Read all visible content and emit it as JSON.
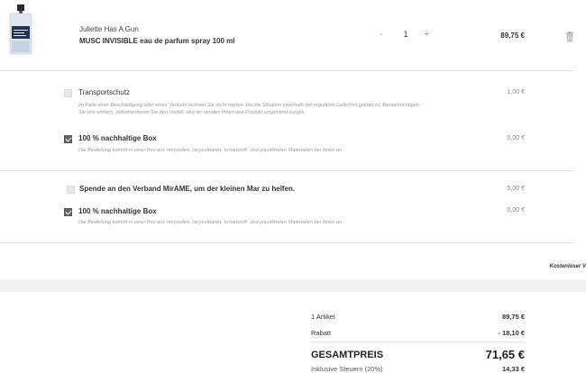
{
  "product": {
    "brand": "Juliette Has A Gun",
    "name": "MUSC INVISIBLE eau de parfum spray 100 ml",
    "qty_minus": "-",
    "quantity": "1",
    "qty_plus": "+",
    "price": "89,75 €",
    "image_icon": "perfume-bottle-icon",
    "remove_icon": "trash-icon"
  },
  "options_group1": [
    {
      "title": "Transportschutz",
      "description": "Im Falle einer Beschädigung oder eines Verlusts müssen Sie nicht warten, bis die Situation innerhalb der regulären Lieferfrist geklärt ist. Benachrichtigen Sie uns einfach, dokumentieren Sie den Vorfall, und wir senden Ihnen das Produkt umgehend zurück.",
      "price": "1,00 €",
      "checked": false
    },
    {
      "title": "100 % nachhaltige Box",
      "description": "Die Bestellung kommt in einer Box aus recycelten, recycelbaren, schadstoff- und plastikfreien Materialien bei Ihnen an.",
      "price": "0,00 €",
      "checked": true
    }
  ],
  "options_group2": [
    {
      "title": "Spende an den Verband MirAME, um der kleinen Mar zu helfen.",
      "price": "5,00 €",
      "checked": false
    },
    {
      "title": "100 % nachhaltige Box",
      "description": "Die Bestellung kommt in einer Box aus recycelten, recycelbaren, schadstoff- und plastikfreien Materialien bei Ihnen an.",
      "price": "0,00 €",
      "checked": true
    }
  ],
  "shipping_note": "Kostenloser V",
  "summary": {
    "items_label": "1 Artikel",
    "items_value": "89,75 €",
    "discount_label": "Rabatt",
    "discount_value": "- 18,10 €",
    "total_label": "GESAMTPREIS",
    "total_value": "71,65 €",
    "tax_label": "Inklusive Steuern (20%)",
    "tax_value": "14,33 €"
  },
  "colors": {
    "checkbox_checked": "#666666",
    "checkbox_unchecked": "#e8e8e8",
    "divider": "#e4e4e4",
    "band": "#f2f2f2"
  }
}
